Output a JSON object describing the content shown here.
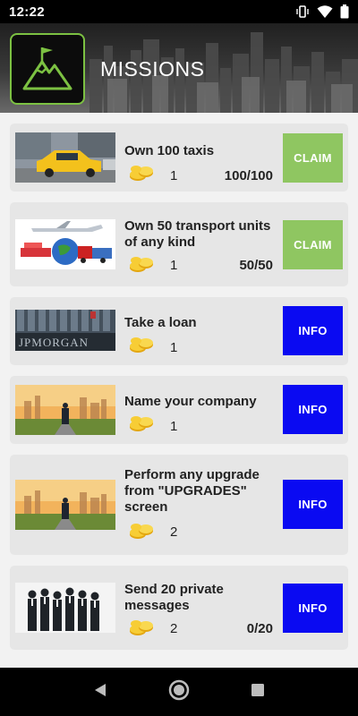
{
  "status": {
    "time": "12:22"
  },
  "header": {
    "title": "MISSIONS",
    "accent": "#7cc142"
  },
  "colors": {
    "claim": "#8fc661",
    "info": "#0a0af2",
    "card": "#e6e6e6"
  },
  "missions": [
    {
      "title": "Own 100 taxis",
      "reward": "1",
      "progress": "100/100",
      "action": "CLAIM",
      "thumb": "taxi-image"
    },
    {
      "title": "Own 50 transport units of any kind",
      "reward": "1",
      "progress": "50/50",
      "action": "CLAIM",
      "thumb": "transport-image"
    },
    {
      "title": "Take a loan",
      "reward": "1",
      "progress": "",
      "action": "INFO",
      "thumb": "bank-building-image"
    },
    {
      "title": "Name your company",
      "reward": "1",
      "progress": "",
      "action": "INFO",
      "thumb": "businessman-city-image"
    },
    {
      "title": "Perform any upgrade from \"UPGRADES\" screen",
      "reward": "2",
      "progress": "",
      "action": "INFO",
      "thumb": "businessman-city-image"
    },
    {
      "title": "Send 20 private messages",
      "reward": "2",
      "progress": "0/20",
      "action": "INFO",
      "thumb": "business-team-image"
    }
  ]
}
